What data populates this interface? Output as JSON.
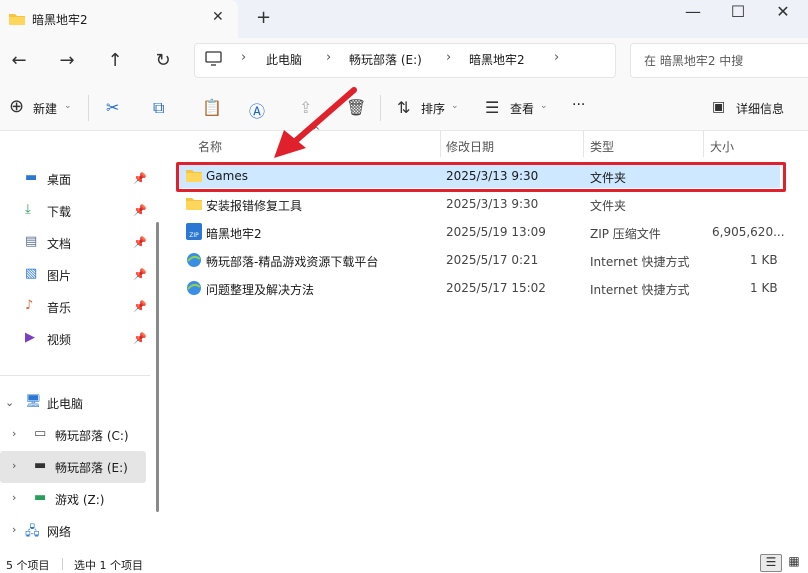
{
  "window": {
    "tab_title": "暗黑地牢2",
    "close_tab": "✕",
    "new_tab": "+",
    "minimize": "—",
    "maximize": "☐",
    "close": "✕"
  },
  "nav": {
    "back": "←",
    "forward": "→",
    "up": "↑",
    "refresh": "↻",
    "breadcrumbs": [
      "此电脑",
      "畅玩部落 (E:)",
      "暗黑地牢2"
    ],
    "search_placeholder": "在 暗黑地牢2 中搜"
  },
  "commands": {
    "new_label": "新建",
    "sort_label": "排序",
    "view_label": "查看",
    "more": "···",
    "details_label": "详细信息"
  },
  "sidebar": {
    "quick_access": [
      {
        "label": "桌面",
        "icon": "desktop-icon"
      },
      {
        "label": "下载",
        "icon": "download-icon"
      },
      {
        "label": "文档",
        "icon": "document-icon"
      },
      {
        "label": "图片",
        "icon": "pictures-icon"
      },
      {
        "label": "音乐",
        "icon": "music-icon"
      },
      {
        "label": "视频",
        "icon": "video-icon"
      }
    ],
    "this_pc": "此电脑",
    "drives": [
      {
        "label": "畅玩部落 (C:)"
      },
      {
        "label": "畅玩部落 (E:)"
      },
      {
        "label": "游戏 (Z:)"
      }
    ],
    "network": "网络"
  },
  "columns": {
    "name": "名称",
    "modified": "修改日期",
    "type": "类型",
    "size": "大小"
  },
  "files": [
    {
      "name": "Games",
      "modified": "2025/3/13 9:30",
      "type": "文件夹",
      "size": "",
      "icon": "folder-icon",
      "selected": true
    },
    {
      "name": "安装报错修复工具",
      "modified": "2025/3/13 9:30",
      "type": "文件夹",
      "size": "",
      "icon": "folder-icon",
      "selected": false
    },
    {
      "name": "暗黑地牢2",
      "modified": "2025/5/19 13:09",
      "type": "ZIP 压缩文件",
      "size": "6,905,620...",
      "icon": "zip-icon",
      "selected": false
    },
    {
      "name": "畅玩部落-精品游戏资源下载平台",
      "modified": "2025/5/17 0:21",
      "type": "Internet 快捷方式",
      "size": "1 KB",
      "icon": "internet-shortcut-icon",
      "selected": false
    },
    {
      "name": "问题整理及解决方法",
      "modified": "2025/5/17 15:02",
      "type": "Internet 快捷方式",
      "size": "1 KB",
      "icon": "internet-shortcut-icon",
      "selected": false
    }
  ],
  "status": {
    "item_count": "5 个项目",
    "selected_count": "选中 1 个项目"
  },
  "colors": {
    "selection": "#cde8ff",
    "annotation_red": "#e0202a",
    "folder_yellow": "#f6c343"
  }
}
